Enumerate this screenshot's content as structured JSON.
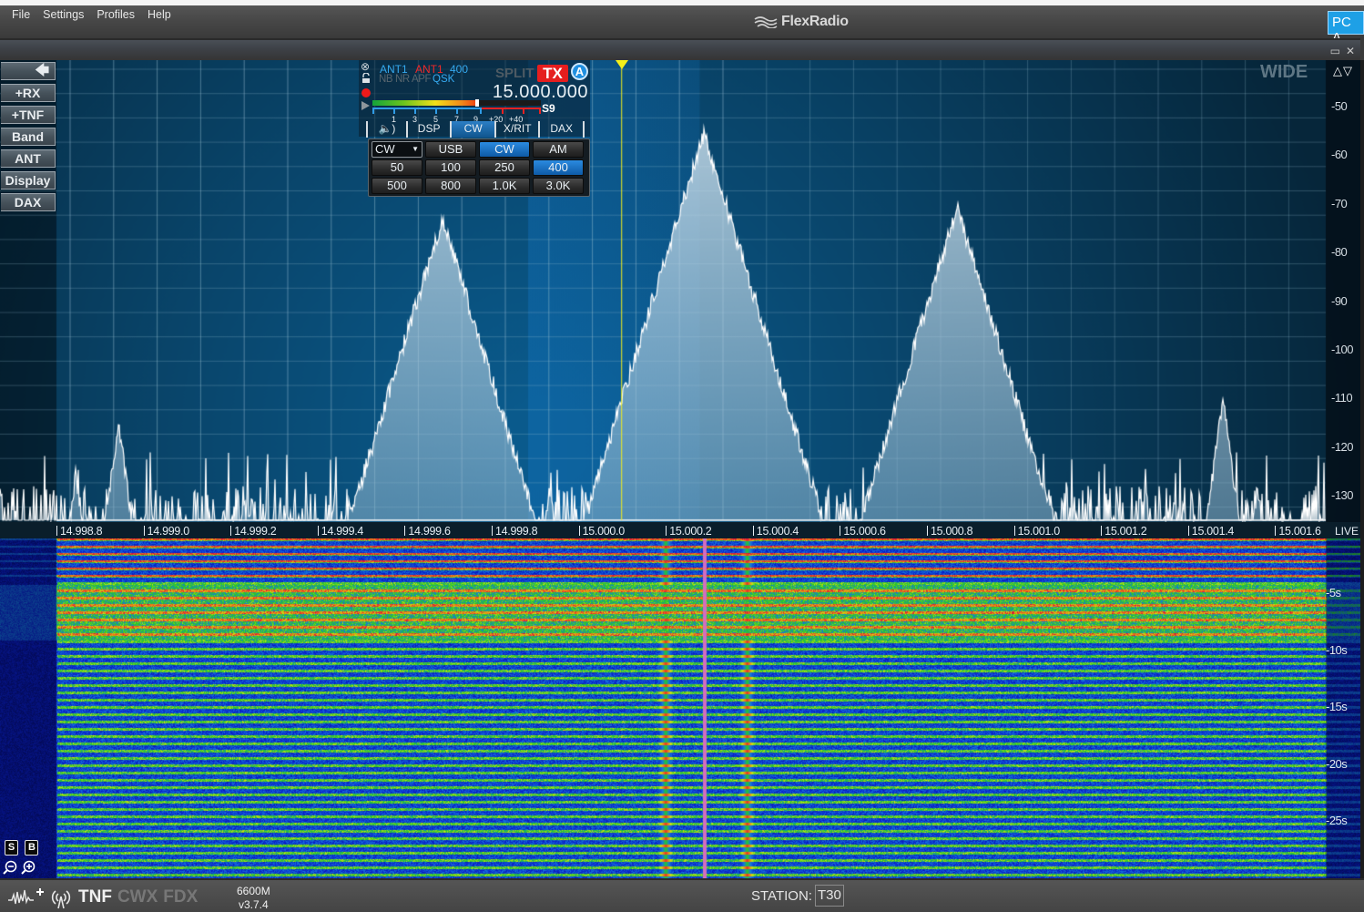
{
  "menu": [
    "File",
    "Settings",
    "Profiles",
    "Help"
  ],
  "brand": "FlexRadio",
  "pc_badge": "PC A",
  "pan_controls": {
    "restore": "▭",
    "close": "✕"
  },
  "side_buttons": [
    {
      "label": "🡄",
      "icon": "back-arrow-icon"
    },
    {
      "label": "+RX"
    },
    {
      "label": "+TNF"
    },
    {
      "label": "Band"
    },
    {
      "label": "ANT"
    },
    {
      "label": "Display"
    },
    {
      "label": "DAX"
    }
  ],
  "spectrum": {
    "mode_label": "WIDE",
    "updown": "△▽",
    "db_ticks": [
      "-50",
      "-60",
      "-70",
      "-80",
      "-90",
      "-100",
      "-110",
      "-120",
      "-130"
    ],
    "freq_ticks": [
      "14.998.8",
      "14.999.0",
      "14.999.2",
      "14.999.4",
      "14.999.6",
      "14.999.8",
      "15.000.0",
      "15.000.2",
      "15.000.4",
      "15.000.6",
      "15.000.8",
      "15.001.0",
      "15.001.2",
      "15.001.4",
      "15.001.6"
    ],
    "live_label": "LIVE",
    "dbm_range": [
      -53,
      -134
    ],
    "freq_range_mhz": [
      14.99868,
      15.00164
    ],
    "filter_passband_mhz": [
      14.99978,
      15.00018
    ],
    "tune_freq_mhz": 14.999998,
    "peaks": [
      {
        "f": 14.998725,
        "dbm": -126
      },
      {
        "f": 14.998825,
        "dbm": -117
      },
      {
        "f": 14.999135,
        "dbm": -130
      },
      {
        "f": 14.99958,
        "dbm": -81
      },
      {
        "f": 14.99983,
        "dbm": -128
      },
      {
        "f": 15.0001,
        "dbm": -97
      },
      {
        "f": 15.00019,
        "dbm": -66
      },
      {
        "f": 15.00029,
        "dbm": -97
      },
      {
        "f": 15.00078,
        "dbm": -79
      },
      {
        "f": 15.0007,
        "dbm": -125
      },
      {
        "f": 15.00082,
        "dbm": -125
      },
      {
        "f": 15.0014,
        "dbm": -113
      },
      {
        "f": 15.00148,
        "dbm": -129
      }
    ]
  },
  "waterfall": {
    "time_ticks": [
      "-5s",
      "-10s",
      "-15s",
      "-20s",
      "-25s"
    ],
    "corner_buttons": [
      "S",
      "B"
    ]
  },
  "slice": {
    "rx_ant": "ANT1",
    "tx_ant": "ANT1",
    "filter_width": "400",
    "dsp_flags": "NB NR APF",
    "qsk": "QSK",
    "split": "SPLIT",
    "tx": "TX",
    "letter": "A",
    "frequency": "15.000.000",
    "s_reading": "S9",
    "smeter_fraction": 0.62,
    "smeter_labels": [
      "1",
      "3",
      "5",
      "7",
      "9",
      "+20",
      "+40"
    ],
    "tabs": [
      {
        "label": "🔈)",
        "icon": "speaker-icon"
      },
      {
        "label": "DSP"
      },
      {
        "label": "CW",
        "active": true
      },
      {
        "label": "X/RIT"
      },
      {
        "label": "DAX"
      }
    ],
    "mode_select": "CW",
    "mode_buttons": [
      {
        "label": "USB"
      },
      {
        "label": "CW",
        "active": true
      },
      {
        "label": "AM"
      }
    ],
    "filter_buttons": [
      {
        "label": "50"
      },
      {
        "label": "100"
      },
      {
        "label": "250"
      },
      {
        "label": "400",
        "active": true
      },
      {
        "label": "500"
      },
      {
        "label": "800"
      },
      {
        "label": "1.0K"
      },
      {
        "label": "3.0K"
      }
    ]
  },
  "status": {
    "tnf": "TNF",
    "cwx": "CWX",
    "fdx": "FDX",
    "model": "6600M",
    "version": "v3.7.4",
    "station_label": "STATION:",
    "station_value": "T30"
  }
}
